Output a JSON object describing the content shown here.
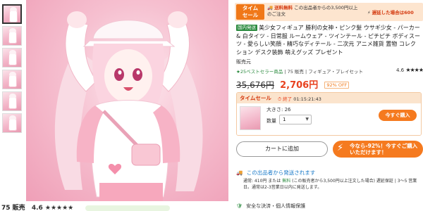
{
  "thumbnails": [
    {
      "label": "thumbnail-1",
      "active": true
    },
    {
      "label": "thumbnail-2",
      "active": false
    },
    {
      "label": "thumbnail-3",
      "active": false
    },
    {
      "label": "thumbnail-4",
      "active": false
    },
    {
      "label": "thumbnail-5",
      "active": false
    },
    {
      "label": "thumbnail-6",
      "active": false
    }
  ],
  "below_image": {
    "sold_text": "75 販売",
    "rating_text": "4.6 ★★★★★"
  },
  "timesale_banner": {
    "badge": "タイム\nセール",
    "note1_em": "送料無料",
    "note1_rest": "この出品者からの3,500円以上のご注文",
    "note2_em": "遅延した場合は600"
  },
  "product": {
    "domestic_badge": "国内発送",
    "title": "美少女フィギュア 勝利の女神・ピンク髪 ウサギ少女 - パーカー & 白タイツ - 日常服 ルームウェア - ツインテール - ピチピチ ボディスーツ - 愛らしい笑顔 - 精巧なディテール - 二次元 アニメ雑貨 置物 コレクション デスク装飾 萌えグッズ プレゼント",
    "seller_label": "販売元",
    "meta_bestseller": "★25ベストセラー商品",
    "meta_sales": "| 75 販売",
    "meta_category": "フィギュア・プレイセット",
    "rating_value": "4.6",
    "rating_stars": "★★★★",
    "old_price": "35,676円",
    "new_price": "2,706円",
    "off_badge": "92% OFF"
  },
  "timesale_box": {
    "label": "タイムセール",
    "timer_prefix": "⏱ 終了",
    "timer_value": "01:15:21:43",
    "size_label": "大きさ: 26",
    "qty_label": "数量",
    "qty_value": "1",
    "buy_now": "今すぐ購入"
  },
  "actions": {
    "cart_button": "カートに追加",
    "promo_button": "今なら-92%！今すぐご購入いただけます！"
  },
  "shipping": {
    "heading": "この出品者から発送されます",
    "detail_prefix": "通常: 410円 または",
    "detail_free": "無料",
    "detail_rest": "(この販売者から3,500円以上注文した場合) 遅延保証 | 3〜5 営業日。通常は2-3営業日以内に発送します。",
    "secure": "安全な決済・個人情報保護"
  },
  "colors": {
    "accent_orange": "#f57a1f",
    "price_red": "#e8421f",
    "green": "#2a8a3e",
    "link_blue": "#1a7ac8"
  }
}
